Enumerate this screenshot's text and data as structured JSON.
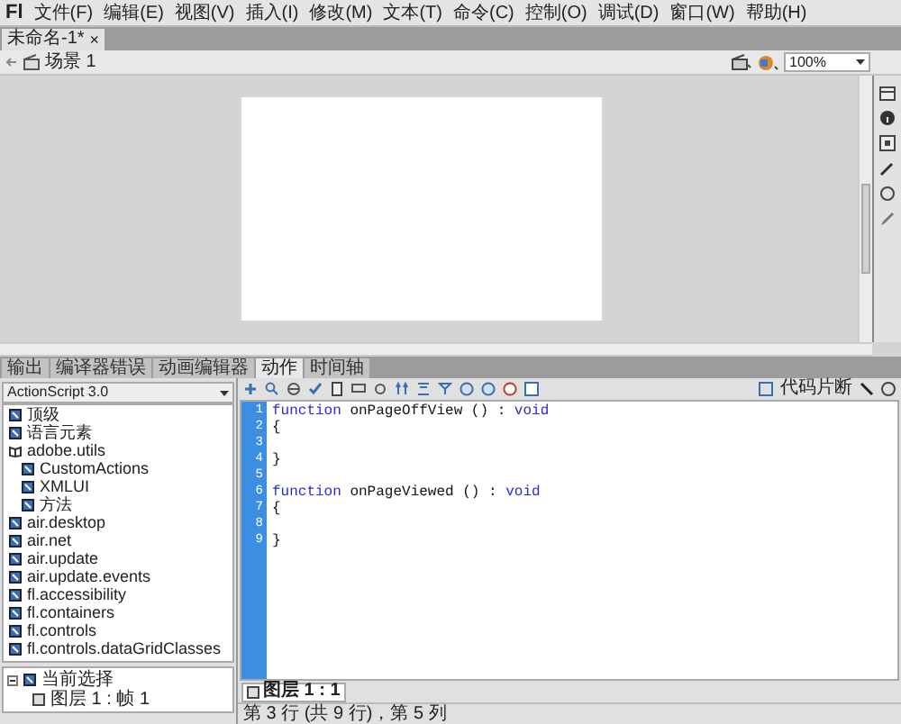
{
  "app": {
    "logo": "Fl"
  },
  "menu": [
    "文件(F)",
    "编辑(E)",
    "视图(V)",
    "插入(I)",
    "修改(M)",
    "文本(T)",
    "命令(C)",
    "控制(O)",
    "调试(D)",
    "窗口(W)",
    "帮助(H)"
  ],
  "document_tab": {
    "title": "未命名-1*",
    "close": "×"
  },
  "scene": {
    "label": "场景 1",
    "zoom": "100%"
  },
  "panel_tabs": [
    {
      "label": "输出",
      "selected": false
    },
    {
      "label": "编译器错误",
      "selected": false
    },
    {
      "label": "动画编辑器",
      "selected": false
    },
    {
      "label": "动作",
      "selected": true
    },
    {
      "label": "时间轴",
      "selected": false
    }
  ],
  "actions": {
    "language": "ActionScript 3.0",
    "toolbox": [
      {
        "label": "顶级",
        "kind": "closed"
      },
      {
        "label": "语言元素",
        "kind": "closed"
      },
      {
        "label": "adobe.utils",
        "kind": "open",
        "children": [
          {
            "label": "CustomActions",
            "kind": "closed"
          },
          {
            "label": "XMLUI",
            "kind": "closed"
          },
          {
            "label": "方法",
            "kind": "closed"
          }
        ]
      },
      {
        "label": "air.desktop",
        "kind": "closed"
      },
      {
        "label": "air.net",
        "kind": "closed"
      },
      {
        "label": "air.update",
        "kind": "closed"
      },
      {
        "label": "air.update.events",
        "kind": "closed"
      },
      {
        "label": "fl.accessibility",
        "kind": "closed"
      },
      {
        "label": "fl.containers",
        "kind": "closed"
      },
      {
        "label": "fl.controls",
        "kind": "closed"
      },
      {
        "label": "fl.controls.dataGridClasses",
        "kind": "closed"
      }
    ],
    "selection_tree": [
      {
        "label": "当前选择",
        "expanded": true,
        "children": [
          {
            "label": "图层 1 : 帧 1"
          }
        ]
      }
    ],
    "code_snippets": "代码片断",
    "code": [
      {
        "number": "1",
        "tokens": [
          {
            "text": "function",
            "kind": "keyword"
          },
          {
            "text": " onPageOffView () : ",
            "kind": "plain"
          },
          {
            "text": "void",
            "kind": "keyword"
          }
        ]
      },
      {
        "number": "2",
        "tokens": [
          {
            "text": "{",
            "kind": "plain"
          }
        ]
      },
      {
        "number": "3"
      },
      {
        "number": "4",
        "tokens": [
          {
            "text": "}",
            "kind": "plain"
          }
        ]
      },
      {
        "number": "5"
      },
      {
        "number": "6",
        "tokens": [
          {
            "text": "function",
            "kind": "keyword"
          },
          {
            "text": " onPageViewed () : ",
            "kind": "plain"
          },
          {
            "text": "void",
            "kind": "keyword"
          }
        ]
      },
      {
        "number": "7",
        "tokens": [
          {
            "text": "{",
            "kind": "plain"
          }
        ]
      },
      {
        "number": "8"
      },
      {
        "number": "9",
        "tokens": [
          {
            "text": "}",
            "kind": "plain"
          }
        ]
      }
    ],
    "script_tab": "图层 1 : 1",
    "status": "第 3 行 (共 9 行)，第 5 列"
  }
}
